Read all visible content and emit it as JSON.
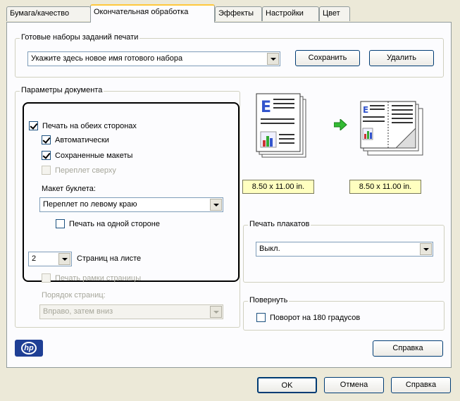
{
  "tabs": [
    {
      "label": "Бумага/качество"
    },
    {
      "label": "Окончательная обработка"
    },
    {
      "label": "Эффекты"
    },
    {
      "label": "Настройки"
    },
    {
      "label": "Цвет"
    }
  ],
  "presets": {
    "title": "Готовые наборы заданий печати",
    "value": "Укажите здесь новое имя готового набора",
    "save_label": "Сохранить",
    "delete_label": "Удалить"
  },
  "doc_params": {
    "title": "Параметры документа",
    "duplex_label": "Печать на обеих сторонах",
    "auto_label": "Автоматически",
    "saved_layouts_label": "Сохраненные макеты",
    "flip_top_label": "Переплет сверху",
    "booklet_label": "Макет буклета:",
    "booklet_value": "Переплет по левому краю",
    "one_side_label": "Печать на одной стороне",
    "pages_per_sheet_value": "2",
    "pages_per_sheet_label": "Страниц на листе",
    "page_borders_label": "Печать рамки страницы",
    "page_order_label": "Порядок страниц:",
    "page_order_value": "Вправо, затем вниз"
  },
  "preview": {
    "source_size": "8.50 x 11.00 in.",
    "target_size": "8.50 x 11.00 in."
  },
  "poster": {
    "title": "Печать плакатов",
    "value": "Выкл."
  },
  "rotate": {
    "title": "Повернуть",
    "rotate_label": "Поворот на 180 градусов"
  },
  "help_label": "Справка",
  "logo_text": "hp",
  "dialog": {
    "ok_label": "OK",
    "cancel_label": "Отмена",
    "help_label": "Справка"
  },
  "colors": {
    "accent": "#ffc83c",
    "check": "#21a121",
    "hp_blue": "#1f3f95"
  }
}
